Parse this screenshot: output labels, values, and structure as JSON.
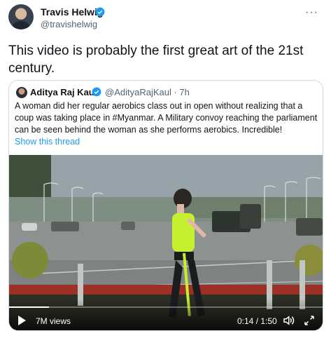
{
  "author": {
    "name": "Travis Helwig",
    "handle": "@travishelwig"
  },
  "tweet": {
    "text": "This video is probably the first great art of the 21st century."
  },
  "more_label": "···",
  "quote": {
    "name": "Aditya Raj Kaul",
    "handle": "@AdityaRajKaul · 7h",
    "text": "A woman did her regular aerobics class out in open without realizing that a coup was taking place in #Myanmar. A Military convoy reaching the parliament can be seen behind the woman as she performs aerobics. Incredible!",
    "show_thread": "Show this thread"
  },
  "video": {
    "views": "7M views",
    "time": "0:14 / 1:50",
    "progress": 0.127
  },
  "colors": {
    "accent": "#1d9bf0",
    "verified": "#1d9bf0"
  },
  "icons": [
    "avatar",
    "verified-icon",
    "play-icon",
    "volume-icon",
    "fullscreen-icon"
  ]
}
